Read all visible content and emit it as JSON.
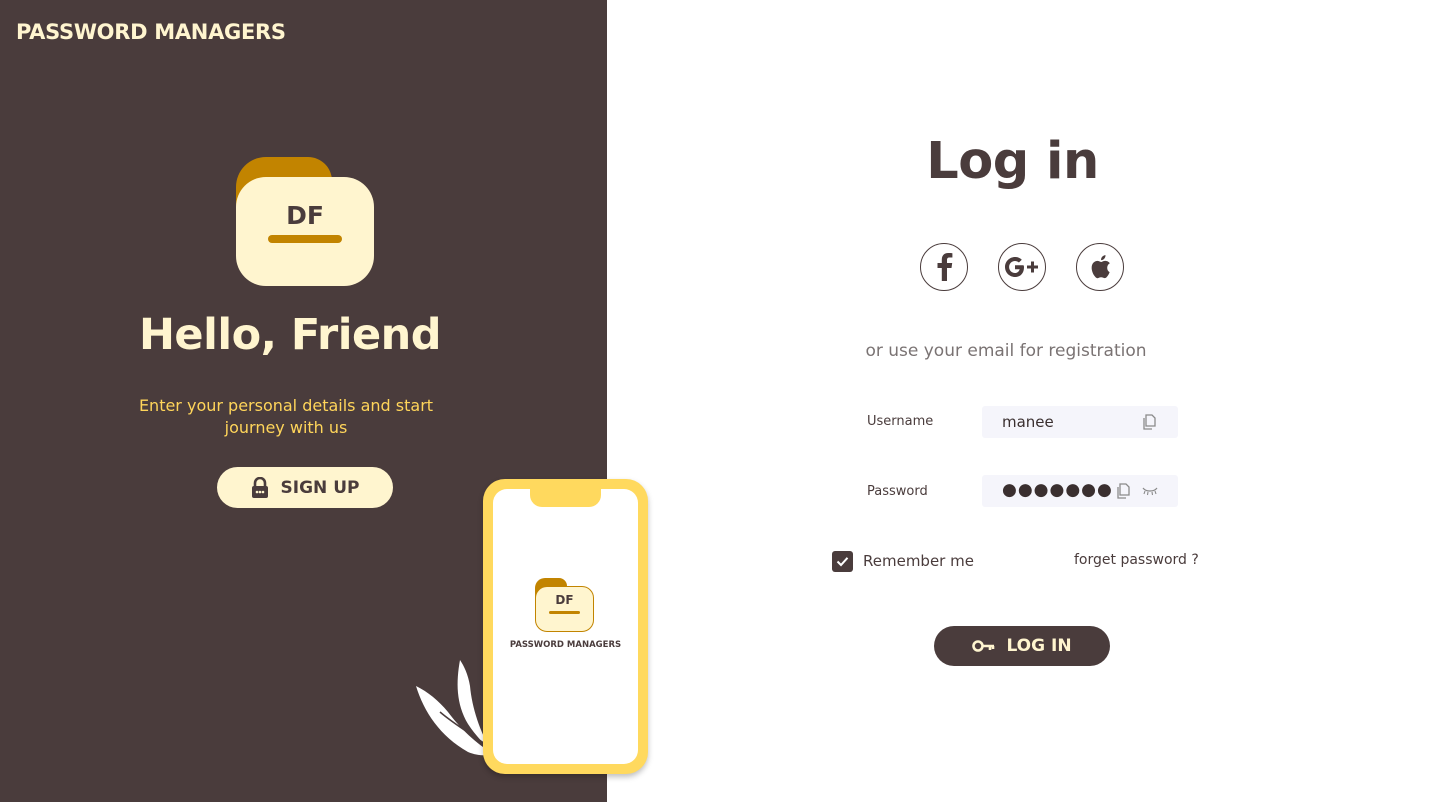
{
  "brand": {
    "title": "PASSWORD MANAGERS"
  },
  "welcome": {
    "logo_initials": "DF",
    "heading": "Hello, Friend",
    "tagline": "Enter your personal details and start journey with us",
    "signup_label": "SIGN UP",
    "signup_icon": "lock-icon"
  },
  "phone": {
    "logo_initials": "DF",
    "app_name": "PASSWORD MANAGERS"
  },
  "login": {
    "title": "Log in",
    "social": [
      {
        "name": "facebook-icon",
        "glyph": "f"
      },
      {
        "name": "google-plus-icon",
        "glyph": "G+"
      },
      {
        "name": "apple-icon",
        "glyph": "apple"
      }
    ],
    "divider_text": "or use your email for registration",
    "username": {
      "label": "Username",
      "value": "manee",
      "icon": "copy-icon"
    },
    "password": {
      "label": "Password",
      "value": "●●●●●●●",
      "icons": [
        "copy-icon",
        "eye-closed-icon"
      ]
    },
    "remember": {
      "label": "Remember me",
      "checked": true
    },
    "forget_label": "forget password ?",
    "button_label": "LOG IN",
    "button_icon": "key-icon"
  },
  "colors": {
    "panel_bg": "#4a3c3c",
    "cream": "#fff5cf",
    "accent_yellow": "#ffd55a",
    "folder_gold": "#c28400"
  }
}
